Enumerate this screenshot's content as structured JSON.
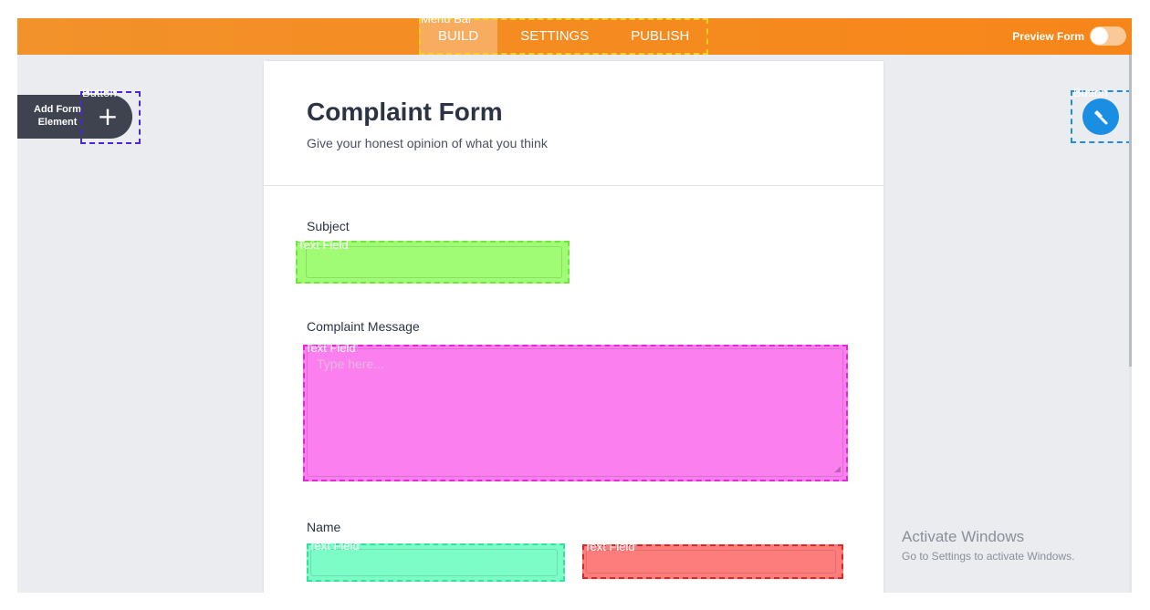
{
  "annotations": {
    "menu_bar": "Menu Bar",
    "button": "Button",
    "text_field": "Text Field"
  },
  "topbar": {
    "tabs": [
      {
        "label": "BUILD",
        "active": true
      },
      {
        "label": "SETTINGS",
        "active": false
      },
      {
        "label": "PUBLISH",
        "active": false
      }
    ],
    "preview_label": "Preview Form",
    "preview_enabled": false
  },
  "sidebar": {
    "add_element_label": "Add Form Element",
    "add_icon": "plus-icon"
  },
  "right_panel": {
    "icon": "paint-roller-icon"
  },
  "form": {
    "title": "Complaint Form",
    "subtitle": "Give your honest opinion of what you think",
    "fields": {
      "subject": {
        "label": "Subject",
        "value": ""
      },
      "message": {
        "label": "Complaint Message",
        "placeholder": "Type here...",
        "value": ""
      },
      "name": {
        "label": "Name",
        "first_value": "",
        "last_value": ""
      }
    }
  },
  "watermark": {
    "title": "Activate Windows",
    "subtitle": "Go to Settings to activate Windows."
  },
  "colors": {
    "topbar": "#f58a1f",
    "dark_button": "#3e434f",
    "blue_button": "#1a8ee2",
    "background": "#eaecf0"
  }
}
